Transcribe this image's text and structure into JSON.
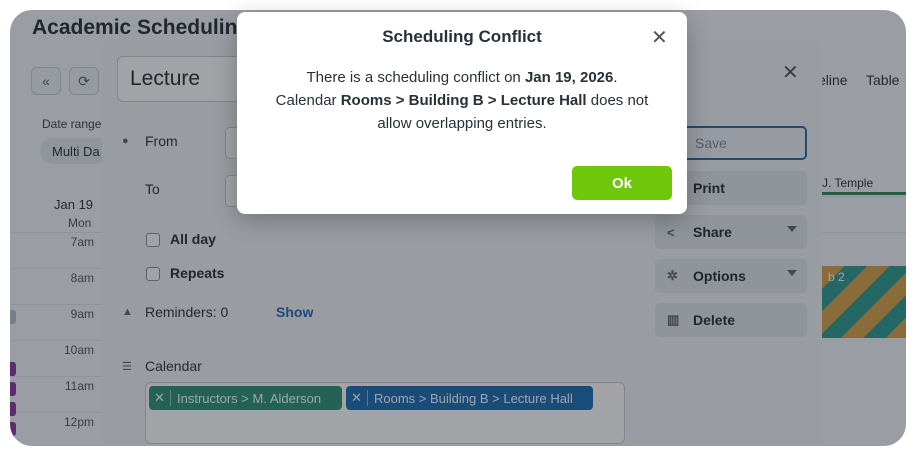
{
  "app": {
    "title": "Academic Schedulin"
  },
  "toolbar": {
    "prev_icon": "double-chevron-left-icon",
    "refresh_icon": "refresh-icon"
  },
  "date_range": {
    "label": "Date range",
    "value": "Multi Da"
  },
  "day_column": {
    "date": "Jan 19",
    "day": "Mon"
  },
  "hours": [
    "7am",
    "8am",
    "9am",
    "10am",
    "11am",
    "12pm"
  ],
  "views": {
    "timeline": "eline",
    "table": "Table"
  },
  "resource_column": {
    "header": "J. Temple",
    "event_label": "b 2"
  },
  "editor": {
    "title_value": "Lecture",
    "from_label": "From",
    "to_label": "To",
    "all_day_label": "All day",
    "repeats_label": "Repeats",
    "reminders_label": "Reminders: 0",
    "show_link": "Show",
    "calendar_label": "Calendar",
    "calendar_tags": [
      {
        "label": "Instructors > M. Alderson",
        "color": "#2e9478"
      },
      {
        "label": "Rooms > Building B > Lecture Hall",
        "color": "#1f6fb2"
      }
    ],
    "actions": {
      "save": "Save",
      "print": "Print",
      "share": "Share",
      "options": "Options",
      "delete": "Delete"
    }
  },
  "dialog": {
    "title": "Scheduling Conflict",
    "msg_prefix": "There is a scheduling conflict on ",
    "msg_date": "Jan 19, 2026",
    "msg_mid": "Calendar ",
    "msg_calendar": "Rooms > Building B > Lecture Hall",
    "msg_suffix": " does not allow overlapping entries.",
    "ok_label": "Ok"
  },
  "colors": {
    "accent": "#1f6fb2",
    "ok_button": "#6fc70c",
    "tag_green": "#2e9478"
  }
}
